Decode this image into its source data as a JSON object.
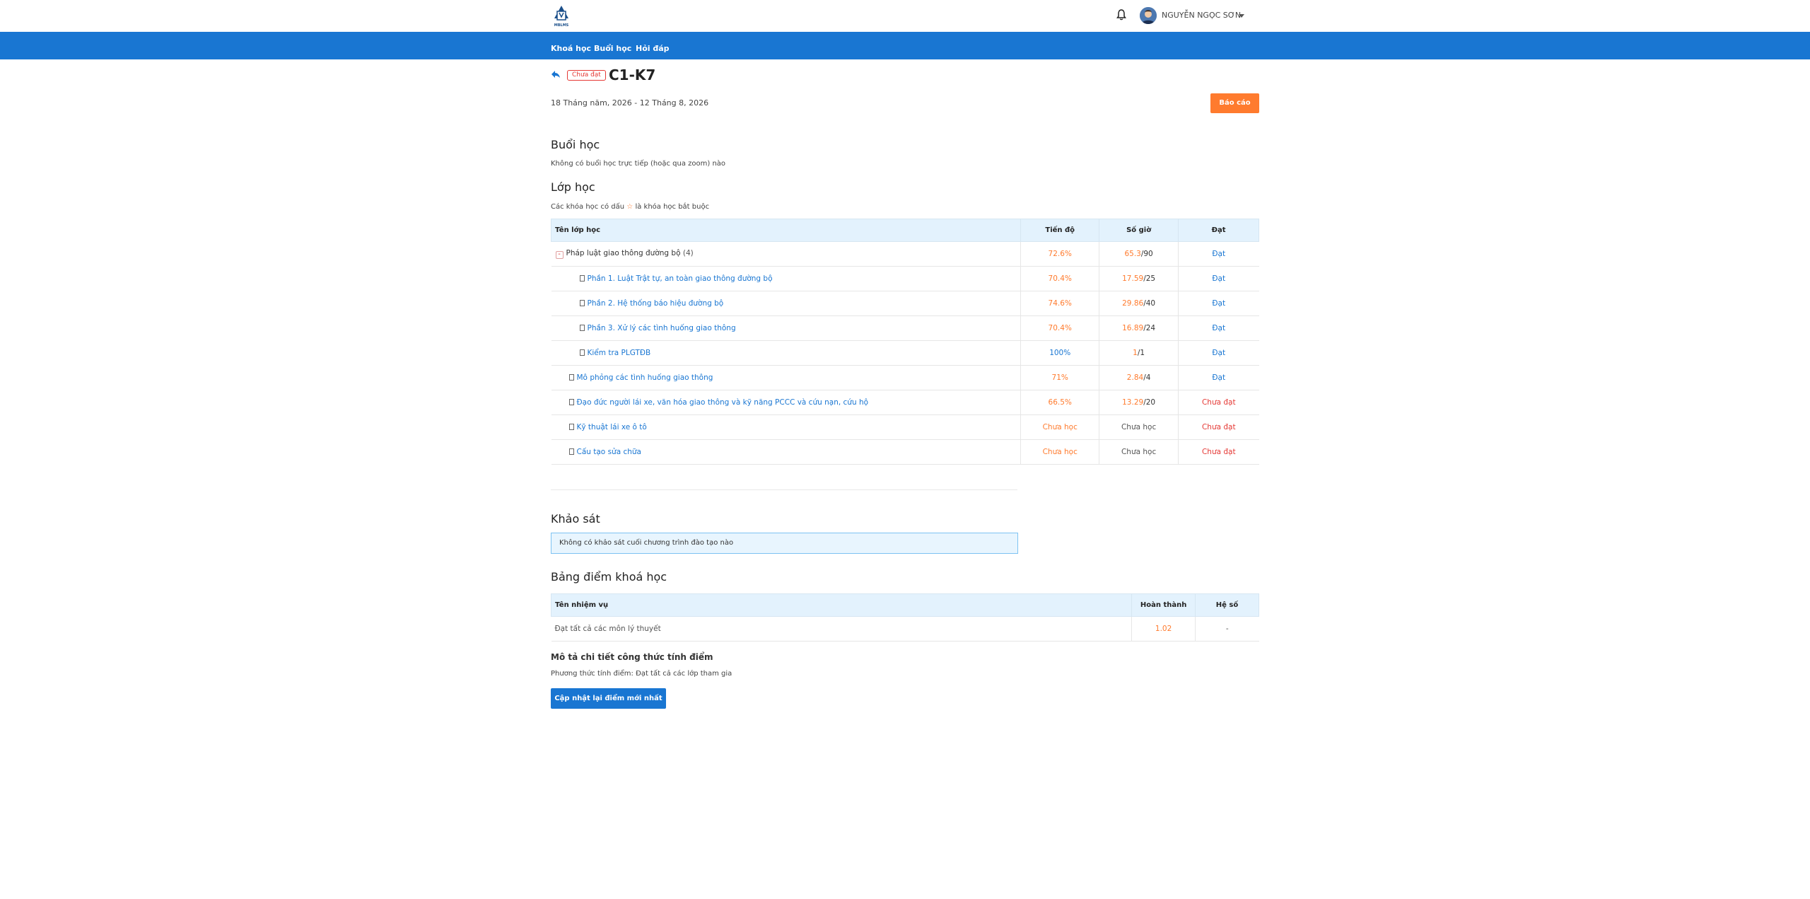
{
  "header": {
    "user_name": "NGUYỄN NGỌC SƠN",
    "logo_text": "MBLMS"
  },
  "nav": {
    "items": [
      "Khoá học",
      "Buổi học",
      "Hỏi đáp"
    ]
  },
  "course": {
    "status": "Chưa đạt",
    "title": "C1-K7",
    "date_range": "18 Tháng năm, 2026 - 12 Tháng 8, 2026",
    "report_label": "Báo cáo"
  },
  "sessions": {
    "heading": "Buổi học",
    "empty_text": "Không có buổi học trực tiếp (hoặc qua zoom) nào"
  },
  "classes": {
    "heading": "Lớp học",
    "note_before": "Các khóa học có dấu",
    "note_star": "☆",
    "note_after": "là khóa học bắt buộc",
    "columns": [
      "Tên lớp học",
      "Tiến độ",
      "Số giờ",
      "Đạt"
    ],
    "rows": [
      {
        "name": "Pháp luật giao thông đường bộ",
        "count": "(4)",
        "progress": "72.6%",
        "hours_done": "65.3",
        "hours_total": "/90",
        "status": "Đạt"
      },
      {
        "name": "Phần 1. Luật Trật tự, an toàn giao thông đường bộ",
        "progress": "70.4%",
        "hours_done": "17.59",
        "hours_total": "/25",
        "status": "Đạt"
      },
      {
        "name": "Phần 2. Hệ thống báo hiệu đường bộ",
        "progress": "74.6%",
        "hours_done": "29.86",
        "hours_total": "/40",
        "status": "Đạt"
      },
      {
        "name": "Phần 3. Xử lý các tình huống giao thông",
        "progress": "70.4%",
        "hours_done": "16.89",
        "hours_total": "/24",
        "status": "Đạt"
      },
      {
        "name": "Kiểm tra PLGTĐB",
        "progress": "100%",
        "hours_done": "1",
        "hours_total": "/1",
        "status": "Đạt"
      },
      {
        "name": "Mô phỏng các tình huống giao thông",
        "progress": "71%",
        "hours_done": "2.84",
        "hours_total": "/4",
        "status": "Đạt"
      },
      {
        "name": "Đạo đức người lái xe, văn hóa giao thông và kỹ năng PCCC và cứu nạn, cứu hộ",
        "progress": "66.5%",
        "hours_done": "13.29",
        "hours_total": "/20",
        "status": "Chưa đạt"
      },
      {
        "name": "Kỹ thuật lái xe ô tô",
        "progress": "Chưa học",
        "hours_text": "Chưa học",
        "status": "Chưa đạt"
      },
      {
        "name": "Cấu tạo sửa chữa",
        "progress": "Chưa học",
        "hours_text": "Chưa học",
        "status": "Chưa đạt"
      }
    ]
  },
  "survey": {
    "heading": "Khảo sát",
    "empty_text": "Không có khảo sát cuối chương trình đào tạo nào"
  },
  "scores": {
    "heading": "Bảng điểm khoá học",
    "columns": [
      "Tên nhiệm vụ",
      "Hoàn thành",
      "Hệ số"
    ],
    "rows": [
      {
        "task": "Đạt tất cả các môn lý thuyết",
        "completion": "1.02",
        "coefficient": "-"
      }
    ],
    "formula_heading": "Mô tả chi tiết công thức tính điểm",
    "formula_text": "Phương thức tính điểm: Đạt tất cả các lớp tham gia",
    "update_label": "Cập nhật lại điểm mới nhất"
  },
  "colors": {
    "primary": "#1976d2",
    "accent": "#ff7b2e",
    "danger": "#e53935",
    "header_bg": "#e3f2fd"
  }
}
